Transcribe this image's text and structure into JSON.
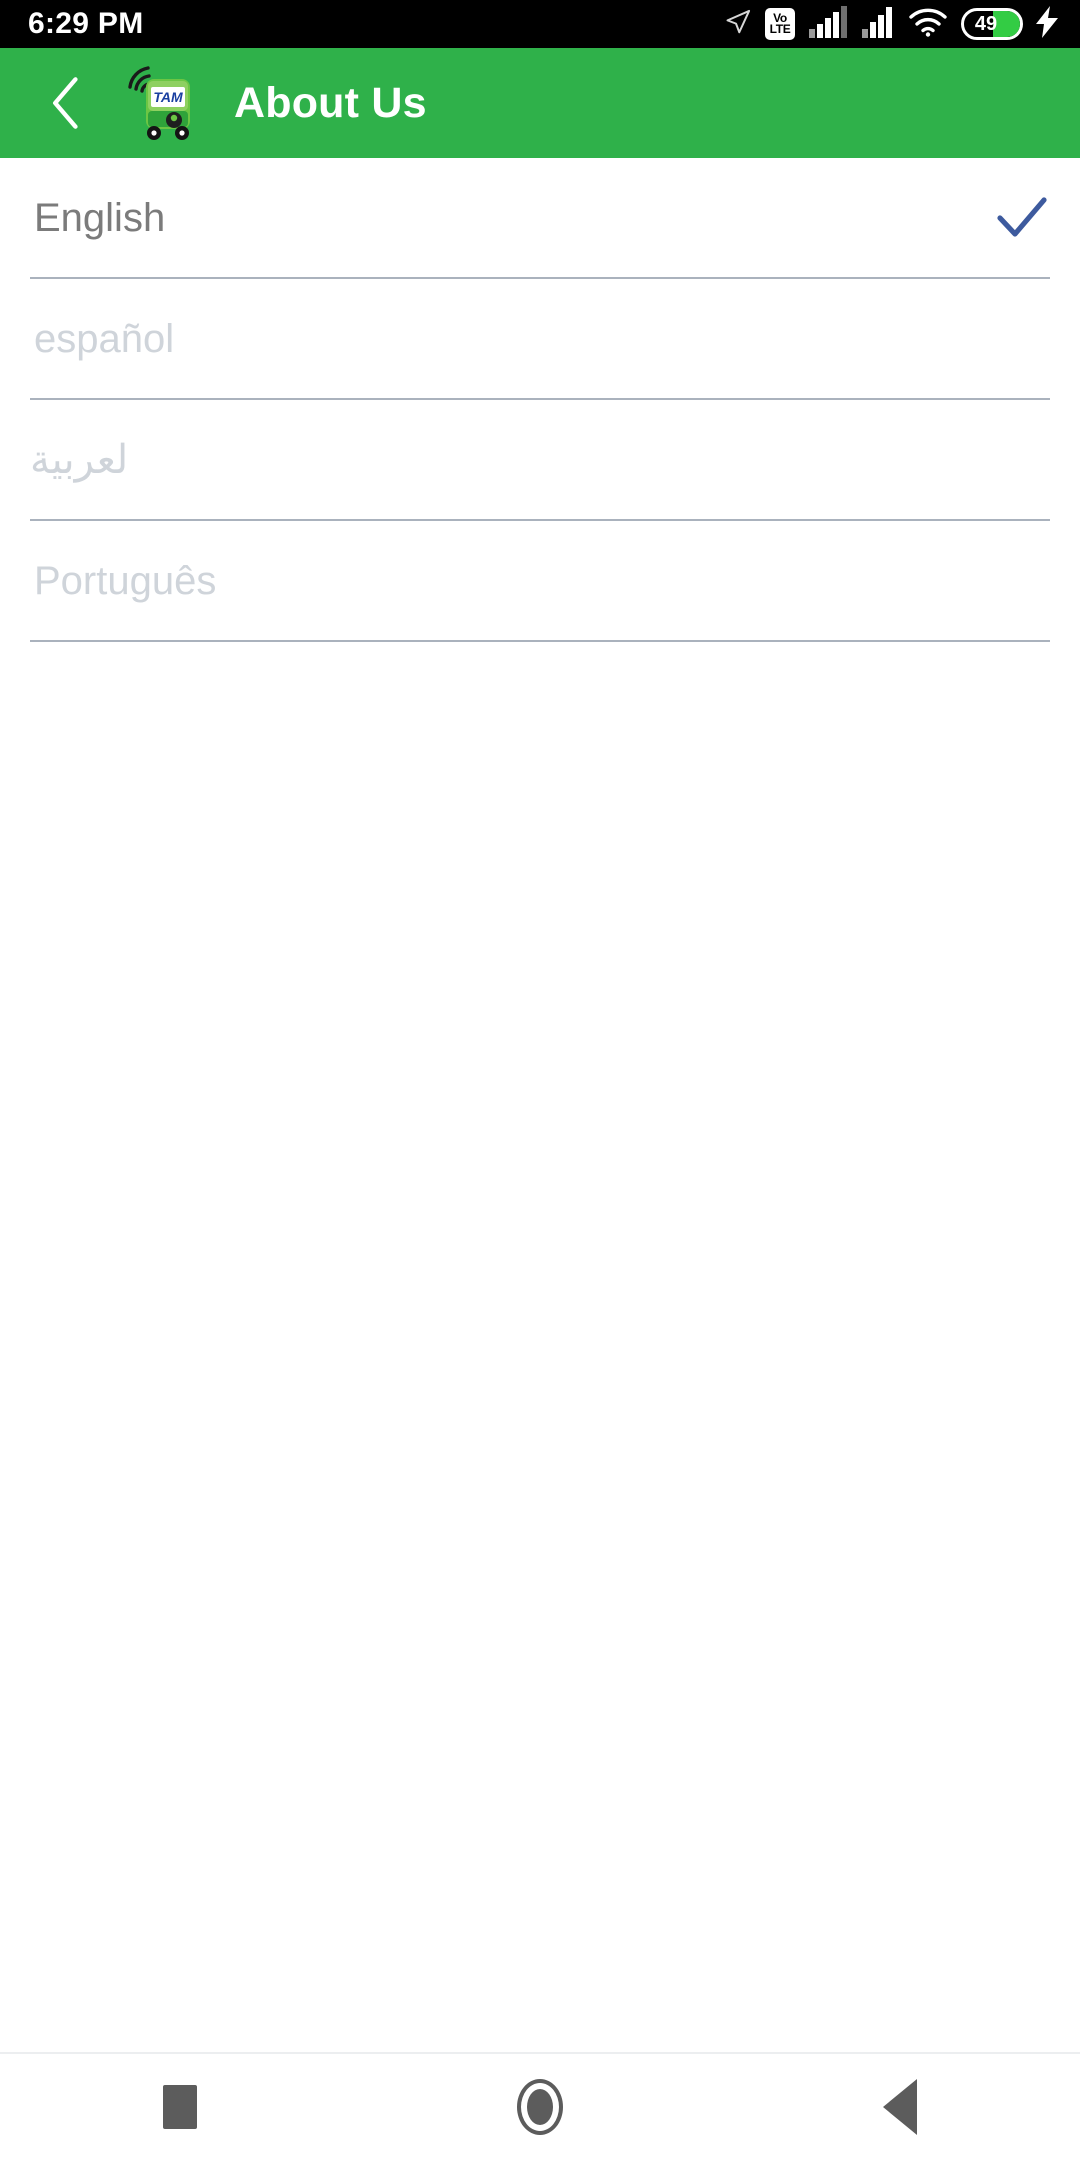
{
  "statusbar": {
    "time": "6:29 PM",
    "battery_level": "49",
    "battery_percent": 49,
    "volte_top": "Vo",
    "volte_bottom": "LTE",
    "icons": [
      "location-arrow-icon",
      "volte-icon",
      "signal-sim1-icon",
      "signal-sim2-icon",
      "wifi-icon",
      "battery-icon",
      "charging-bolt-icon"
    ],
    "colors": {
      "background": "#000000",
      "foreground": "#ffffff",
      "battery_fill": "#33cc44"
    }
  },
  "appbar": {
    "title": "About Us",
    "back_label": "Back",
    "logo_text": "TAM",
    "colors": {
      "background": "#2fb14a",
      "title": "#ffffff",
      "logo_body": "#64bf3c",
      "logo_panel": "#ffffff",
      "logo_text": "#1a3fa0"
    }
  },
  "languages": {
    "items": [
      {
        "label": "English",
        "selected": true,
        "rtl": false
      },
      {
        "label": "español",
        "selected": false,
        "rtl": false
      },
      {
        "label": "لعربية",
        "selected": false,
        "rtl": true
      },
      {
        "label": "Português",
        "selected": false,
        "rtl": false
      }
    ],
    "colors": {
      "selected_text": "#7b7b7b",
      "unselected_text": "#cfd4da",
      "divider": "#aab2bd",
      "check": "#3d5a9e"
    }
  },
  "navbar": {
    "buttons": [
      {
        "name": "recents",
        "icon": "square-icon"
      },
      {
        "name": "home",
        "icon": "circle-icon"
      },
      {
        "name": "back",
        "icon": "triangle-left-icon"
      }
    ],
    "colors": {
      "icon": "#5c5c5c",
      "background": "#ffffff"
    }
  }
}
